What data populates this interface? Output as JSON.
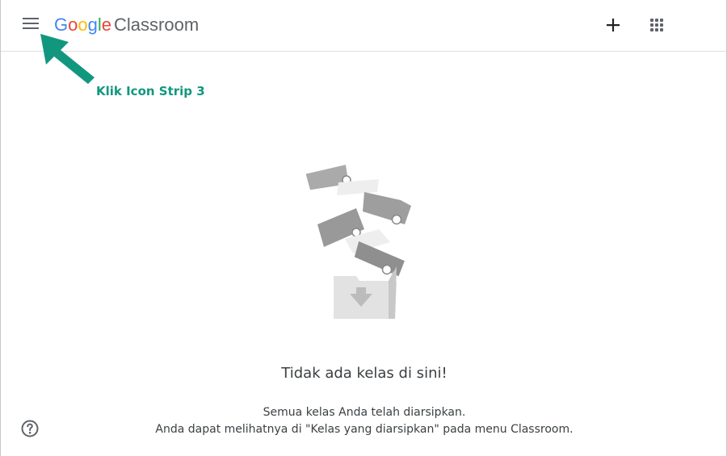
{
  "header": {
    "logo_letters": [
      {
        "char": "G",
        "color": "#4285F4"
      },
      {
        "char": "o",
        "color": "#EA4335"
      },
      {
        "char": "o",
        "color": "#FBBC05"
      },
      {
        "char": "g",
        "color": "#4285F4"
      },
      {
        "char": "l",
        "color": "#34A853"
      },
      {
        "char": "e",
        "color": "#EA4335"
      }
    ],
    "product_name": "Classroom",
    "menu_icon": "hamburger-menu-icon",
    "add_icon": "plus-icon",
    "apps_icon": "apps-grid-icon"
  },
  "annotation": {
    "label": "Klik Icon Strip 3",
    "color": "#12977f"
  },
  "empty_state": {
    "illustration": "archived-classes-illustration",
    "title": "Tidak ada kelas di sini!",
    "line1": "Semua kelas Anda telah diarsipkan.",
    "line2": "Anda dapat melihatnya di \"Kelas yang diarsipkan\" pada menu Classroom."
  },
  "footer": {
    "help_icon": "help-circle-icon"
  }
}
